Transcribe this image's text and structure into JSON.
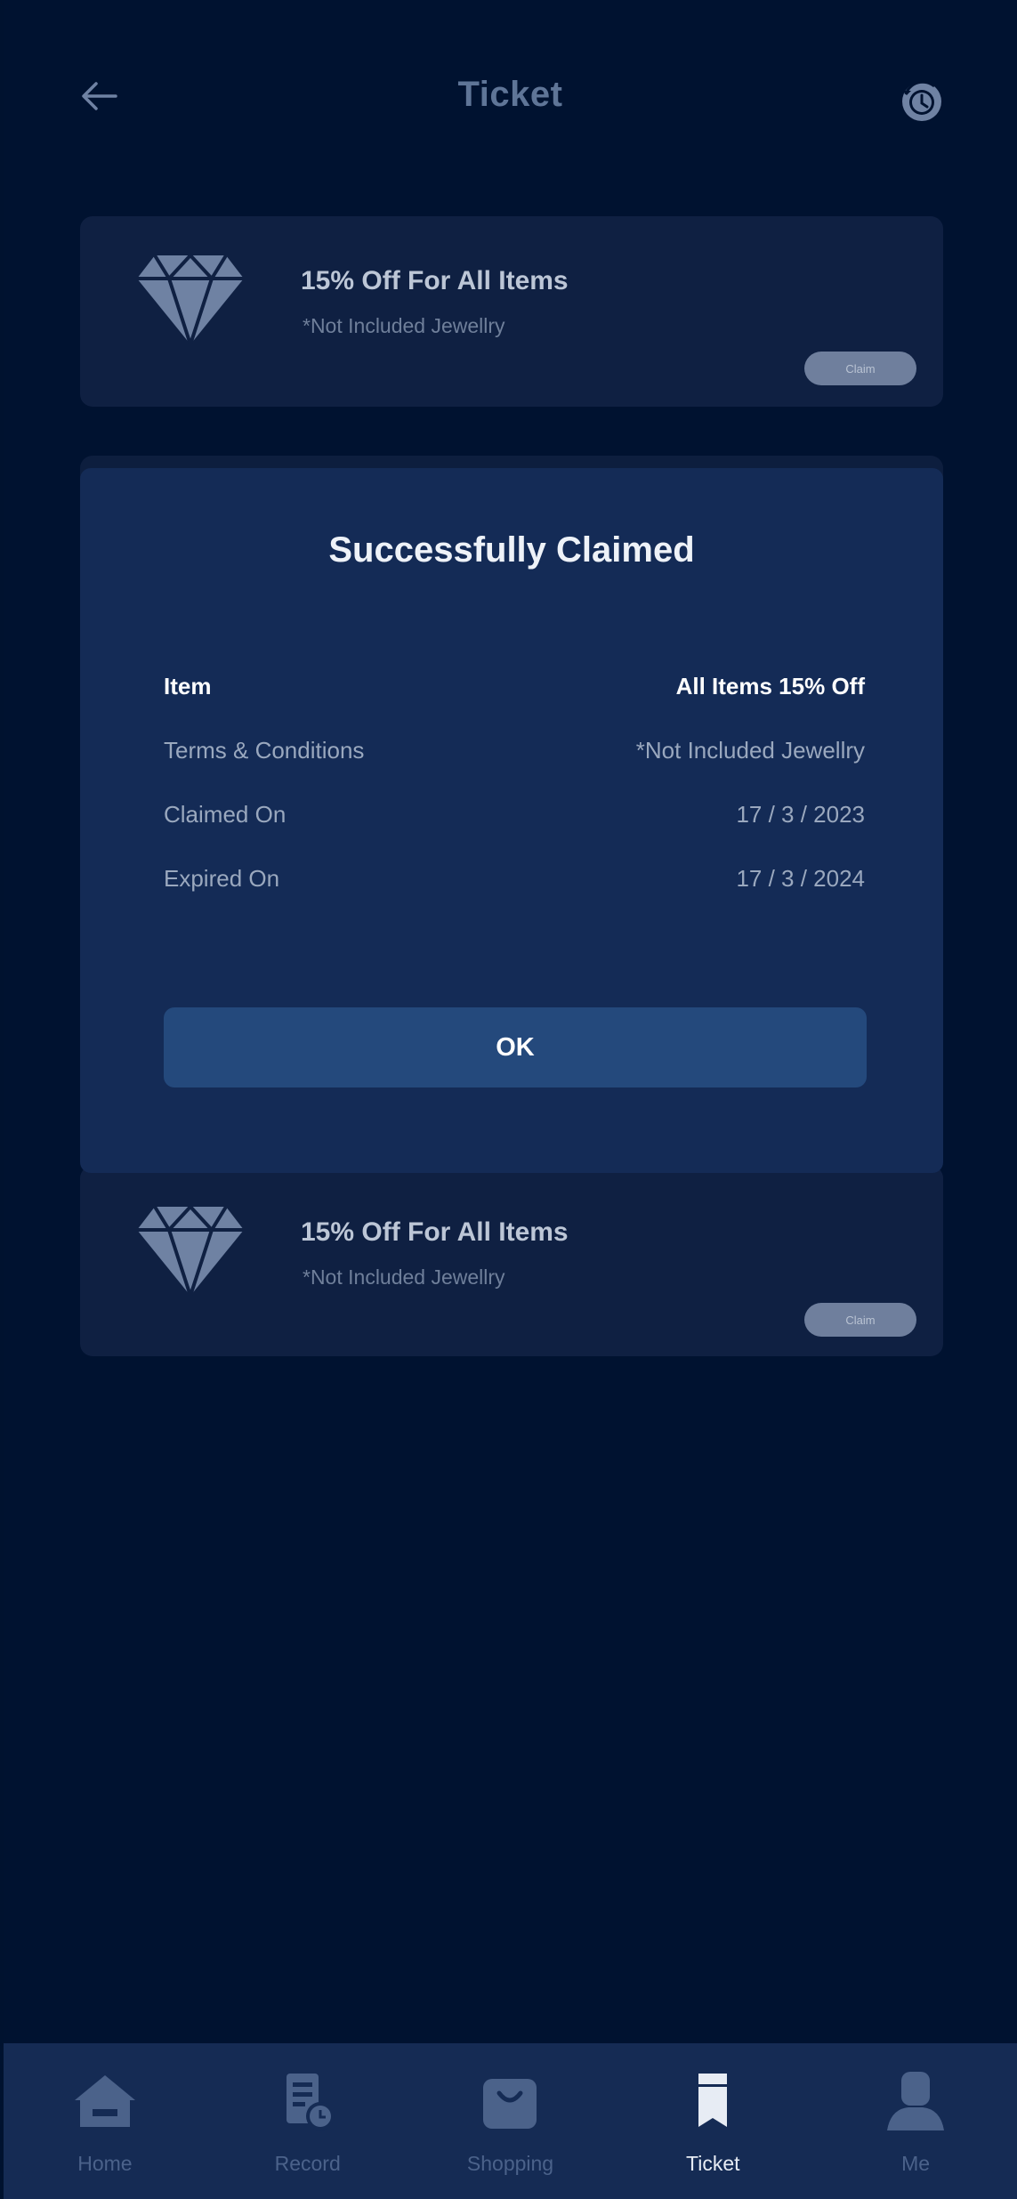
{
  "header": {
    "title": "Ticket",
    "back_icon": "arrow-left-icon",
    "history_icon": "history-clock-icon"
  },
  "tickets": [
    {
      "title": "15% Off For All Items",
      "subtitle": "*Not Included Jewellry",
      "claim_label": "Claim",
      "icon": "diamond-icon"
    },
    {
      "title": "15% Off For All Items",
      "subtitle": "*Not Included Jewellry",
      "claim_label": "Claim",
      "icon": "diamond-icon"
    }
  ],
  "modal": {
    "title": "Successfully Claimed",
    "rows": [
      {
        "label": "Item",
        "value": "All Items 15% Off"
      },
      {
        "label": "Terms & Conditions",
        "value": "*Not Included Jewellry"
      },
      {
        "label": "Claimed On",
        "value": "17 / 3 / 2023"
      },
      {
        "label": "Expired On",
        "value": "17 / 3 / 2024"
      }
    ],
    "ok_label": "OK"
  },
  "nav": [
    {
      "label": "Home",
      "icon": "home-icon",
      "active": false
    },
    {
      "label": "Record",
      "icon": "record-icon",
      "active": false
    },
    {
      "label": "Shopping",
      "icon": "shopping-bag-icon",
      "active": false
    },
    {
      "label": "Ticket",
      "icon": "ticket-icon",
      "active": true
    },
    {
      "label": "Me",
      "icon": "user-icon",
      "active": false
    }
  ],
  "colors": {
    "background": "#001230",
    "card": "#0f2042",
    "modal": "#142b56",
    "button": "#24497c",
    "nav_bar": "#152b54"
  }
}
